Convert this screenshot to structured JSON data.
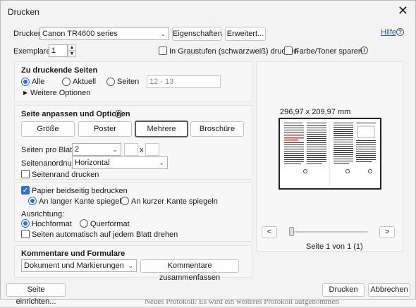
{
  "window": {
    "title": "Drucken",
    "close": "✕"
  },
  "printer": {
    "label": "Drucker:",
    "value": "Canon TR4600 series",
    "properties": "Eigenschaften",
    "advanced": "Erweitert...",
    "help": "Hilfe"
  },
  "copies": {
    "label": "Exemplare:",
    "value": "1",
    "grayscale": "In Graustufen (schwarzweiß) drucken",
    "save_toner": "Farbe/Toner sparen"
  },
  "pages": {
    "title": "Zu druckende Seiten",
    "all": "Alle",
    "current": "Aktuell",
    "pages": "Seiten",
    "pages_placeholder": "12 - 13",
    "more_options": "Weitere Optionen"
  },
  "sizing": {
    "title": "Seite anpassen und Optionen",
    "tabs": [
      "Größe",
      "Poster",
      "Mehrere",
      "Broschüre"
    ],
    "pages_per_sheet_label": "Seiten pro Blatt:",
    "pages_per_sheet_value": "2",
    "times": "x",
    "page_order_label": "Seitenanordnung:",
    "page_order_value": "Horizontal",
    "print_border": "Seitenrand drucken"
  },
  "duplex": {
    "label": "Papier beidseitig bedrucken",
    "long_edge": "An langer Kante spiegeln",
    "short_edge": "An kurzer Kante spiegeln"
  },
  "orientation": {
    "label": "Ausrichtung:",
    "portrait": "Hochformat",
    "landscape": "Querformat",
    "auto_rotate": "Seiten automatisch auf jedem Blatt drehen"
  },
  "comments": {
    "title": "Kommentare und Formulare",
    "value": "Dokument und Markierungen",
    "summarize": "Kommentare zusammenfassen"
  },
  "preview": {
    "size": "296,97 x 209,97 mm",
    "page_info": "Seite 1 von 1 (1)",
    "prev": "<",
    "next": ">"
  },
  "footer": {
    "page_setup": "Seite einrichten...",
    "print": "Drucken",
    "cancel": "Abbrechen"
  },
  "background_text": "Neues Protokoll: Es wird ein weiteres Protokoll aufgenommen"
}
